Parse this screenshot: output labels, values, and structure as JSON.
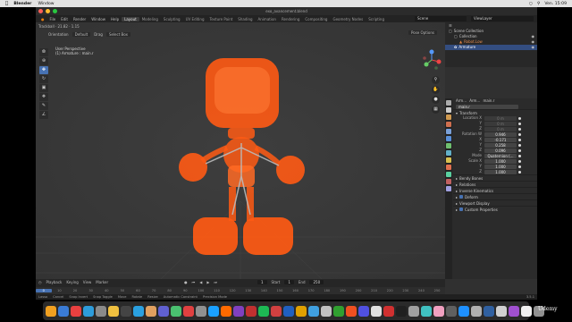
{
  "mac_menubar": {
    "app_name": "Blender",
    "menu_window": "Window",
    "clock": "Ven. 15:09"
  },
  "window": {
    "title": "exo_avancement.blend",
    "menus": [
      "File",
      "Edit",
      "Render",
      "Window",
      "Help"
    ],
    "workspaces": [
      "Layout",
      "Modeling",
      "Sculpting",
      "UV Editing",
      "Texture Paint",
      "Shading",
      "Animation",
      "Rendering",
      "Compositing",
      "Geometry Nodes",
      "Scripting"
    ],
    "active_workspace": "Layout",
    "scene": "Scene",
    "view_layer": "ViewLayer"
  },
  "viewport": {
    "header": {
      "tool_hint": "Trackball · 21.82 · 1.15",
      "mode": "Pose Mode",
      "view": "View",
      "select": "Select",
      "pose": "Pose"
    },
    "header2": {
      "orientation": "Orientation",
      "orientation_value": "Default",
      "drag": "Drag",
      "drag_value": "Select Box"
    },
    "pose_options": "Pose Options",
    "info_line1": "User Perspective",
    "info_line2": "(1) Armature : main.r",
    "tools": [
      "select-box",
      "cursor",
      "move",
      "rotate",
      "scale",
      "transform",
      "annotate",
      "measure"
    ],
    "active_tool_index": 2,
    "character_color": "#ff5a14"
  },
  "outliner": {
    "rows": [
      {
        "label": "Scene Collection",
        "indent": 0,
        "selected": false
      },
      {
        "label": "Collection",
        "indent": 1,
        "selected": false
      },
      {
        "label": "Robot.Low",
        "indent": 2,
        "selected": false
      },
      {
        "label": "Armature",
        "indent": 1,
        "selected": true
      }
    ]
  },
  "properties": {
    "breadcrumb": [
      "Arm…",
      "Arm…",
      "main.r"
    ],
    "bone_name": "main.r",
    "transform_title": "Transform",
    "fields": [
      {
        "label": "Location X",
        "value": "0 m",
        "grey": true
      },
      {
        "label": "Y",
        "value": "0 m",
        "grey": true
      },
      {
        "label": "Z",
        "value": "0 m",
        "grey": true
      },
      {
        "label": "Rotation W",
        "value": "0.946",
        "grey": false
      },
      {
        "label": "X",
        "value": "-0.171",
        "grey": false
      },
      {
        "label": "Y",
        "value": "0.258",
        "grey": false
      },
      {
        "label": "Z",
        "value": "0.096",
        "grey": false
      },
      {
        "label": "Mode",
        "value": "Quaternion (...",
        "grey": false
      },
      {
        "label": "Scale X",
        "value": "1.000",
        "grey": false
      },
      {
        "label": "Y",
        "value": "1.000",
        "grey": false
      },
      {
        "label": "Z",
        "value": "1.000",
        "grey": false
      }
    ],
    "panels": [
      "Bendy Bones",
      "Relations",
      "Inverse Kinematics",
      "Deform",
      "Viewport Display",
      "Custom Properties"
    ],
    "checked_panels": [
      "Deform",
      "Custom Properties"
    ],
    "tab_colors": [
      "#aaaaaa",
      "#cccccc",
      "#d09a50",
      "#cf6f4f",
      "#7aa0d8",
      "#5a8fd8",
      "#6fbf6f",
      "#62b0c9",
      "#d8c050",
      "#e07050",
      "#5ad0a0",
      "#c06060",
      "#a0a0e0"
    ]
  },
  "timeline": {
    "playback": "Playback",
    "keying": "Keying",
    "view": "View",
    "marker": "Marker",
    "current_frame": "1",
    "start_label": "Start",
    "start": "1",
    "end_label": "End",
    "end": "250",
    "ticks": [
      "0",
      "10",
      "20",
      "30",
      "40",
      "50",
      "60",
      "70",
      "80",
      "90",
      "100",
      "110",
      "120",
      "130",
      "140",
      "150",
      "160",
      "170",
      "180",
      "190",
      "200",
      "210",
      "220",
      "230",
      "240",
      "250"
    ]
  },
  "statusbar": {
    "items": [
      "Lasso",
      "Cancel",
      "Snap Invert",
      "Snap Toggle",
      "Move",
      "Rotate",
      "Resize",
      "Automatic Constraint",
      "Precision Mode"
    ],
    "version": "3.5.1"
  },
  "dock_colors": [
    "#f0a020",
    "#3a7bd5",
    "#e84040",
    "#2d9cdb",
    "#8a8a8a",
    "#f0c040",
    "#444444",
    "#2aa0e0",
    "#e0a060",
    "#6060d0",
    "#4ac070",
    "#e04040",
    "#909090",
    "#1aa0ff",
    "#ff6a00",
    "#8040c0",
    "#c03030",
    "#1db954",
    "#d04040",
    "#2060c0",
    "#e0a000",
    "#40a0e0",
    "#c0c0c0",
    "#30a030",
    "#f05020",
    "#5050e0",
    "#e0e0e0",
    "#d03030",
    "#202020",
    "#a0a0a0",
    "#40c0c0",
    "#f0a0c0",
    "#606060",
    "#1e90ff",
    "#b0b0b0",
    "#3060a0",
    "#d0d0d0",
    "#a050d0",
    "#f0f0f0",
    "#909090"
  ],
  "watermark": "Udemy"
}
